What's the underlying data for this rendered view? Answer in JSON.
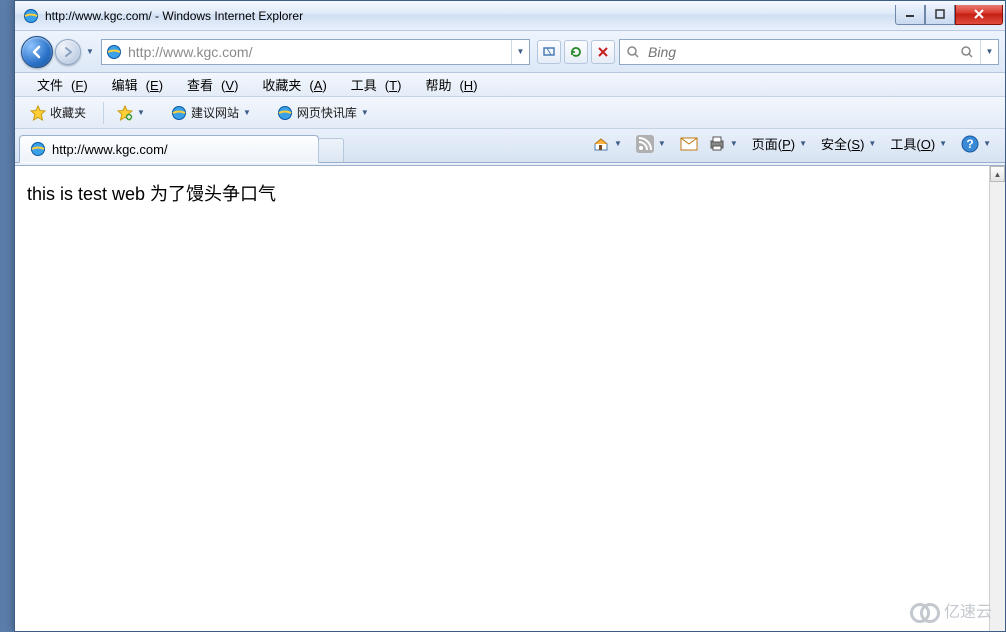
{
  "window": {
    "title": "http://www.kgc.com/ - Windows Internet Explorer"
  },
  "nav": {
    "address": "http://www.kgc.com/",
    "search_placeholder": "Bing"
  },
  "menu": {
    "file": "文件",
    "file_k": "F",
    "edit": "编辑",
    "edit_k": "E",
    "view": "查看",
    "view_k": "V",
    "fav": "收藏夹",
    "fav_k": "A",
    "tools": "工具",
    "tools_k": "T",
    "help": "帮助",
    "help_k": "H"
  },
  "favbar": {
    "favorites": "收藏夹",
    "suggested": "建议网站",
    "slice": "网页快讯库"
  },
  "tabs": {
    "active_title": "http://www.kgc.com/"
  },
  "commandbar": {
    "page": "页面",
    "page_k": "P",
    "safety": "安全",
    "safety_k": "S",
    "tools": "工具",
    "tools_k": "O"
  },
  "page": {
    "body_text": "this is test web 为了馒头争口气"
  },
  "watermark": "亿速云"
}
